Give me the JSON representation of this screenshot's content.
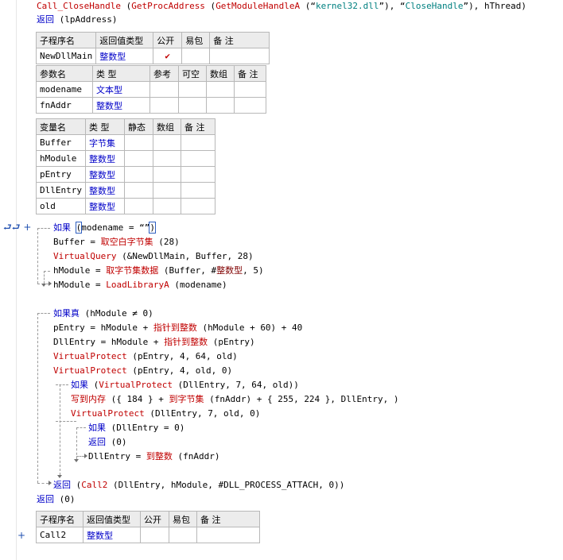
{
  "code": {
    "line1": {
      "fn": "Call_CloseHandle",
      "p1": " (",
      "fn2": "GetProcAddress",
      "p2": " (",
      "fn3": "GetModuleHandleA",
      "p3": " (“",
      "s1": "kernel32.dll",
      "p4": "”), “",
      "s2": "CloseHandle",
      "p5": "”), hThread)"
    },
    "line2": {
      "kw": "返回",
      "rest": " (lpAddress)"
    },
    "if1": {
      "kw": "如果",
      "cursor": "(",
      "cond": "modename = “”",
      "cursor2": ")"
    },
    "buffer_line": {
      "var": "Buffer",
      "op": " = ",
      "fn": "取空白字节集",
      "rest": " (28)"
    },
    "vq_line": {
      "fn": "VirtualQuery",
      "rest": " (&NewDllMain, Buffer, 28)"
    },
    "hmod1_line": {
      "var": "hModule",
      "op": " = ",
      "fn": "取字节集数据",
      "rest1": " (Buffer, #",
      "type": "整数型",
      "rest2": ", 5)"
    },
    "hmod2_line": {
      "var": "hModule",
      "op": " = ",
      "fn": "LoadLibraryA",
      "rest": " (modename)"
    },
    "iftrue": {
      "kw": "如果真",
      "rest": " (hModule ≠ 0)"
    },
    "pentry_line": {
      "var": "pEntry",
      "op": " = hModule + ",
      "fn": "指针到整数",
      "rest": " (hModule + 60) + 40"
    },
    "dllentry_line": {
      "var": "DllEntry",
      "op": " = hModule + ",
      "fn": "指针到整数",
      "rest": " (pEntry)"
    },
    "vp1_line": {
      "fn": "VirtualProtect",
      "rest": " (pEntry, 4, 64, old)"
    },
    "vp2_line": {
      "fn": "VirtualProtect",
      "rest": " (pEntry, 4, old, 0)"
    },
    "if2": {
      "kw": "如果",
      "p": " (",
      "fn": "VirtualProtect",
      "rest": " (DllEntry, 7, 64, old))"
    },
    "write_line": {
      "fn": "写到内存",
      "r1": " ({ 184 } + ",
      "fn2": "到字节集",
      "r2": " (fnAddr) + { 255, 224 }, DllEntry, )"
    },
    "vp3_line": {
      "fn": "VirtualProtect",
      "rest": " (DllEntry, 7, old, 0)"
    },
    "if3": {
      "kw": "如果",
      "rest": " (DllEntry = 0)"
    },
    "ret0_line": {
      "kw": "返回",
      "rest": " (0)"
    },
    "dllentry2_line": {
      "var": "DllEntry",
      "op": " = ",
      "fn": "到整数",
      "rest": " (fnAddr)"
    },
    "retcall_line": {
      "kw": "返回",
      "p": " (",
      "fn": "Call2",
      "rest": " (DllEntry, hModule, #DLL_PROCESS_ATTACH, 0))"
    },
    "ret_final": {
      "kw": "返回",
      "rest": " (0)"
    }
  },
  "sub_table1": {
    "headers": [
      "子程序名",
      "返回值类型",
      "公开",
      "易包",
      "备 注"
    ],
    "row": {
      "name": "NewDllMain",
      "type": "整数型",
      "public": "✔",
      "pkg": "",
      "note": ""
    },
    "param_headers": [
      "参数名",
      "类 型",
      "参考",
      "可空",
      "数组",
      "备 注"
    ],
    "params": [
      {
        "name": "modename",
        "type": "文本型"
      },
      {
        "name": "fnAddr",
        "type": "整数型"
      }
    ]
  },
  "var_table": {
    "headers": [
      "变量名",
      "类 型",
      "静态",
      "数组",
      "备 注"
    ],
    "rows": [
      {
        "name": "Buffer",
        "type": "字节集"
      },
      {
        "name": "hModule",
        "type": "整数型"
      },
      {
        "name": "pEntry",
        "type": "整数型"
      },
      {
        "name": "DllEntry",
        "type": "整数型"
      },
      {
        "name": "old",
        "type": "整数型"
      }
    ]
  },
  "sub_table2": {
    "headers": [
      "子程序名",
      "返回值类型",
      "公开",
      "易包",
      "备 注"
    ],
    "row": {
      "name": "Call2",
      "type": "整数型"
    }
  },
  "gutter": {
    "marker1": "⮐⮐ +",
    "marker2": "+"
  }
}
